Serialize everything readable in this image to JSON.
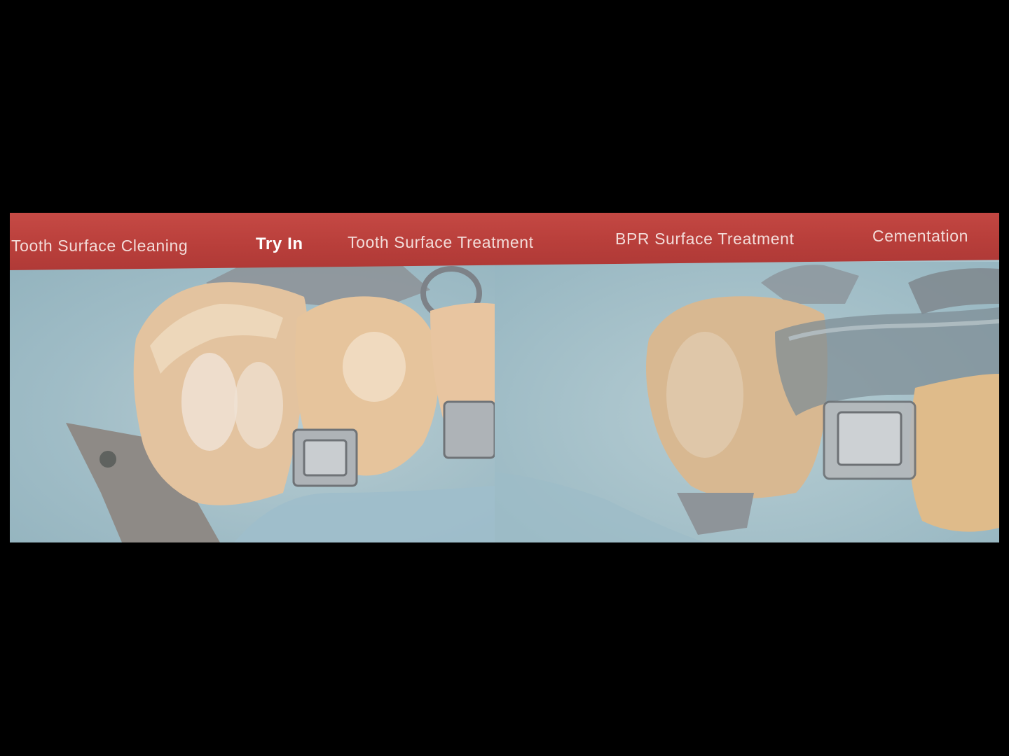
{
  "steps": [
    {
      "label": "Tooth Surface Cleaning",
      "active": false
    },
    {
      "label": "Try In",
      "active": true
    },
    {
      "label": "Tooth  Surface Treatment",
      "active": false
    },
    {
      "label": "BPR Surface Treatment",
      "active": false
    },
    {
      "label": "Cementation",
      "active": false
    }
  ],
  "photos": [
    {
      "subject": "bonded-tooth-with-bracket-clamp"
    },
    {
      "subject": "tooth-with-matrix-band-and-bracket"
    }
  ],
  "colors": {
    "background": "#000000",
    "bar": "#b93f3b",
    "bar_text": "#f3dcd9",
    "active_text": "#ffffff",
    "drape": "#a9c6cf"
  }
}
